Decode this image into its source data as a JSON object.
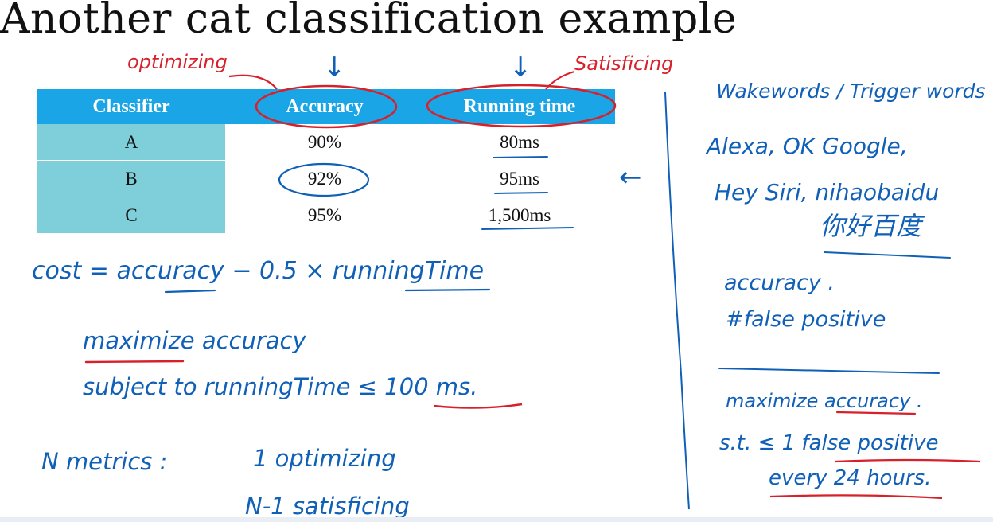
{
  "slide": {
    "title": "Another cat classification example"
  },
  "table": {
    "headers": [
      "Classifier",
      "Accuracy",
      "Running time"
    ],
    "rows": [
      {
        "classifier": "A",
        "accuracy": "90%",
        "running_time": "80ms"
      },
      {
        "classifier": "B",
        "accuracy": "92%",
        "running_time": "95ms"
      },
      {
        "classifier": "C",
        "accuracy": "95%",
        "running_time": "1,500ms"
      }
    ],
    "highlighted_row": "B"
  },
  "annotations": {
    "optimizing_label": "optimizing",
    "satisficing_label": "Satisficing",
    "down_arrow_1": "↓",
    "down_arrow_2": "↓",
    "row_arrow": "←",
    "cost_formula": "cost = accuracy − 0.5 × runningTime",
    "maximize_line": "maximize     accuracy",
    "subject_to_line": "subject to     runningTime ≤ 100 ms.",
    "n_metrics": "N  metrics :",
    "one_optimizing": "1  optimizing",
    "n_minus_1_satisficing": "N-1  satisficing"
  },
  "side_notes": {
    "wakewords": "Wakewords / Trigger words",
    "examples_1": "Alexa,  OK  Google,",
    "examples_2": "Hey Siri,  nihaobaidu",
    "examples_3": "你好百度",
    "accuracy": "accuracy .",
    "false_positive": "#false   positive",
    "maximize": "maximize   accuracy .",
    "st": "s.t. ≤ 1  false positive",
    "every": "every  24  hours."
  },
  "colors": {
    "header_blue": "#1aa5e6",
    "classifier_teal": "#7fcfdb",
    "highlight": "#c0d9f1",
    "ink_blue": "#1060b8",
    "ink_red": "#d8202a"
  }
}
